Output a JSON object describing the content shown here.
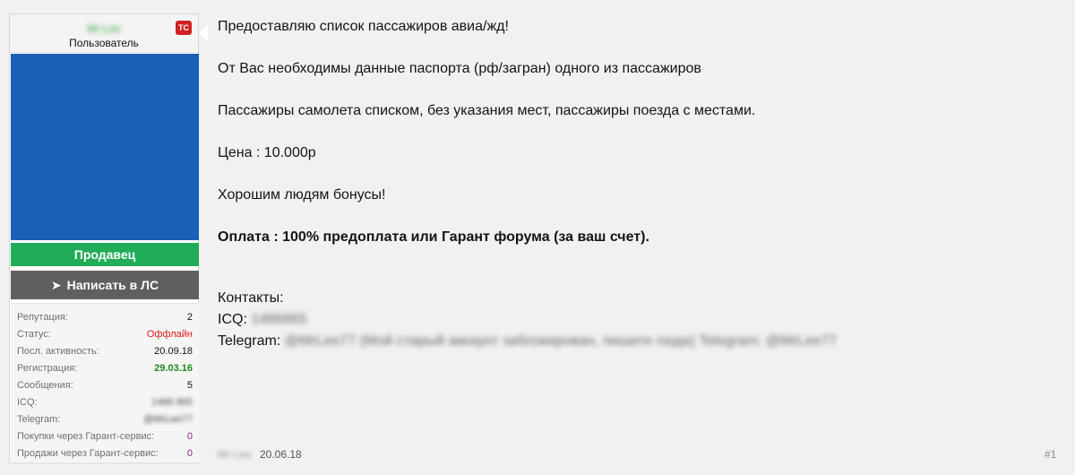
{
  "user": {
    "name": "Mr Lee",
    "title": "Пользователь",
    "badge": "TC",
    "role": "Продавец",
    "pm_button": "Написать в ЛС",
    "stats": [
      {
        "label": "Репутация:",
        "value": "2",
        "style": "normal"
      },
      {
        "label": "Статус:",
        "value": "Оффлайн",
        "style": "red"
      },
      {
        "label": "Посл. активность:",
        "value": "20.09.18",
        "style": "normal"
      },
      {
        "label": "Регистрация:",
        "value": "29.03.16",
        "style": "green"
      },
      {
        "label": "Сообщения:",
        "value": "5",
        "style": "normal"
      },
      {
        "label": "ICQ:",
        "value": "1486 865",
        "style": "blurred"
      },
      {
        "label": "Telegram:",
        "value": "@MrLee77",
        "style": "blurred"
      },
      {
        "label": "Покупки через Гарант-сервис:",
        "value": "0",
        "style": "purple"
      },
      {
        "label": "Продажи через Гарант-сервис:",
        "value": "0",
        "style": "purple"
      }
    ]
  },
  "message": {
    "line1": "Предоставляю список пассажиров авиа/жд!",
    "line2": "От Вас необходимы данные паспорта (рф/загран) одного из пассажиров",
    "line3": "Пассажиры самолета списком, без указания мест, пассажиры поезда с местами.",
    "line4": "Цена : 10.000р",
    "line5": "Хорошим людям бонусы!",
    "line6": "Оплата : 100% предоплата или Гарант форума (за ваш счет).",
    "contacts_label": "Контакты:",
    "icq_label": "ICQ:",
    "icq_value": "1486865",
    "telegram_label": "Telegram:",
    "telegram_value": "@MrLee77 (Мой старый аккаунт заблокирован, пишите сюда) Telegram: @MrLee77"
  },
  "footer": {
    "author": "Mr Lee",
    "date": "20.06.18",
    "post_number": "#1"
  },
  "colors": {
    "avatar_bg": "#1a5fb8",
    "role_bg": "#21ad58",
    "button_bg": "#5f5f5f",
    "badge_bg": "#d32020"
  }
}
